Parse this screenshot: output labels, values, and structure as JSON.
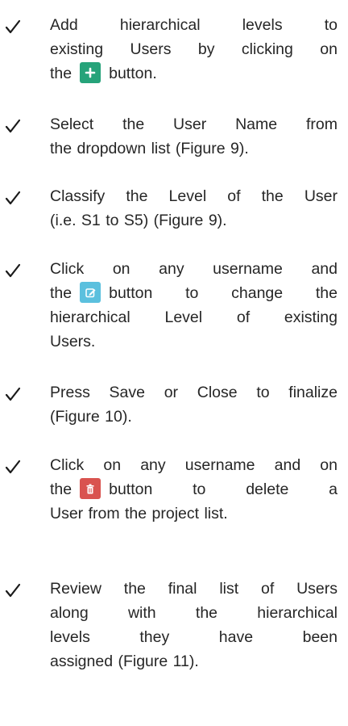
{
  "items": [
    {
      "lines": [
        "Add hierarchical levels to",
        "existing Users by clicking on",
        [
          "the",
          "button."
        ]
      ],
      "icon": "plus-icon",
      "icon_color": "#26a37a"
    },
    {
      "lines": [
        "Select the User Name from",
        "the dropdown list (Figure 9)."
      ]
    },
    {
      "lines": [
        "Classify the Level of the User",
        "(i.e. S1 to S5) (Figure 9)."
      ]
    },
    {
      "lines": [
        "Click on any username and",
        [
          "the",
          "button to change the"
        ],
        "hierarchical Level of existing",
        "Users."
      ],
      "icon": "edit-icon",
      "icon_color": "#5bc0de"
    },
    {
      "lines": [
        "Press Save or Close to finalize",
        "(Figure 10)."
      ]
    },
    {
      "lines": [
        "Click on any username and on",
        [
          "the",
          "button to delete a"
        ],
        "User from the project list."
      ],
      "icon": "trash-icon",
      "icon_color": "#d9534f"
    },
    {
      "lines": [
        "Review the final list of Users",
        "along with the hierarchical",
        "levels they have been",
        "assigned (Figure 11)."
      ]
    }
  ]
}
